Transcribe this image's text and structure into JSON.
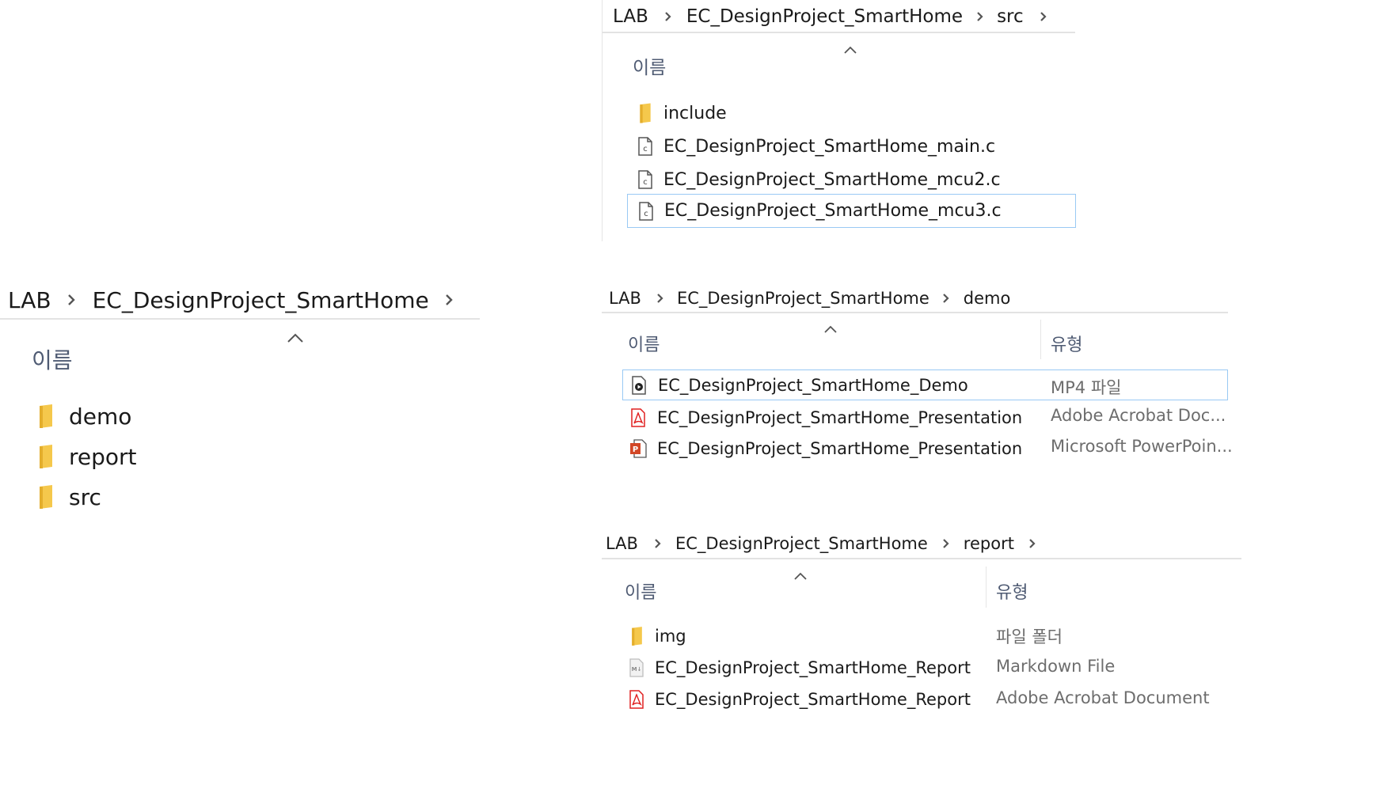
{
  "panel_root": {
    "breadcrumb": [
      "LAB",
      "EC_DesignProject_SmartHome"
    ],
    "column_name": "이름",
    "items": [
      {
        "name": "demo",
        "icon": "folder-icon"
      },
      {
        "name": "report",
        "icon": "folder-icon"
      },
      {
        "name": "src",
        "icon": "folder-icon"
      }
    ]
  },
  "panel_src": {
    "breadcrumb": [
      "LAB",
      "EC_DesignProject_SmartHome",
      "src"
    ],
    "column_name": "이름",
    "items": [
      {
        "name": "include",
        "icon": "folder-icon"
      },
      {
        "name": "EC_DesignProject_SmartHome_main.c",
        "icon": "c-file-icon"
      },
      {
        "name": "EC_DesignProject_SmartHome_mcu2.c",
        "icon": "c-file-icon"
      },
      {
        "name": "EC_DesignProject_SmartHome_mcu3.c",
        "icon": "c-file-icon",
        "selected": true
      }
    ]
  },
  "panel_demo": {
    "breadcrumb": [
      "LAB",
      "EC_DesignProject_SmartHome",
      "demo"
    ],
    "column_name": "이름",
    "column_type": "유형",
    "items": [
      {
        "name": "EC_DesignProject_SmartHome_Demo",
        "type": "MP4 파일",
        "icon": "video-file-icon",
        "selected": true
      },
      {
        "name": "EC_DesignProject_SmartHome_Presentation",
        "type": "Adobe Acrobat Doc...",
        "icon": "pdf-file-icon"
      },
      {
        "name": "EC_DesignProject_SmartHome_Presentation",
        "type": "Microsoft PowerPoin...",
        "icon": "powerpoint-file-icon"
      }
    ]
  },
  "panel_report": {
    "breadcrumb": [
      "LAB",
      "EC_DesignProject_SmartHome",
      "report"
    ],
    "column_name": "이름",
    "column_type": "유형",
    "items": [
      {
        "name": "img",
        "type": "파일 폴더",
        "icon": "folder-icon"
      },
      {
        "name": "EC_DesignProject_SmartHome_Report",
        "type": "Markdown File",
        "icon": "markdown-file-icon"
      },
      {
        "name": "EC_DesignProject_SmartHome_Report",
        "type": "Adobe Acrobat Document",
        "icon": "pdf-file-icon"
      }
    ]
  },
  "colors": {
    "folder": "#f5c84c",
    "pdf": "#e02020",
    "powerpoint": "#d24726",
    "selection_border": "#99c9f4",
    "column_header_text": "#4f5b73",
    "type_text": "#6d6d6d"
  }
}
